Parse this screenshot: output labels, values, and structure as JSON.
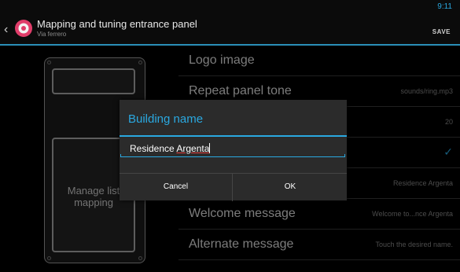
{
  "action_bar": {
    "title": "Mapping and tuning entrance panel",
    "subtitle": "Via ferrero",
    "clock": "9:11",
    "save_label": "SAVE",
    "up_icon": "chevron-left-icon",
    "app_icon": "app-settings-icon",
    "accent_color": "#2aa8e0"
  },
  "panel": {
    "keypad_label": "Manage list mapping"
  },
  "settings": [
    {
      "label": "Logo image",
      "value": ""
    },
    {
      "label": "Repeat panel tone",
      "value": "sounds/ring.mp3"
    },
    {
      "label": "",
      "value": "20"
    },
    {
      "label": "",
      "value": "",
      "checked": true
    },
    {
      "label": "",
      "value": "Residence Argenta"
    },
    {
      "label": "Welcome message",
      "value": "Welcome to...nce Argenta"
    },
    {
      "label": "Alternate message",
      "value": "Touch the desired name."
    }
  ],
  "dialog": {
    "title": "Building name",
    "input_value_plain": "Residence ",
    "input_value_flagged": "Argenta",
    "cancel_label": "Cancel",
    "ok_label": "OK"
  }
}
